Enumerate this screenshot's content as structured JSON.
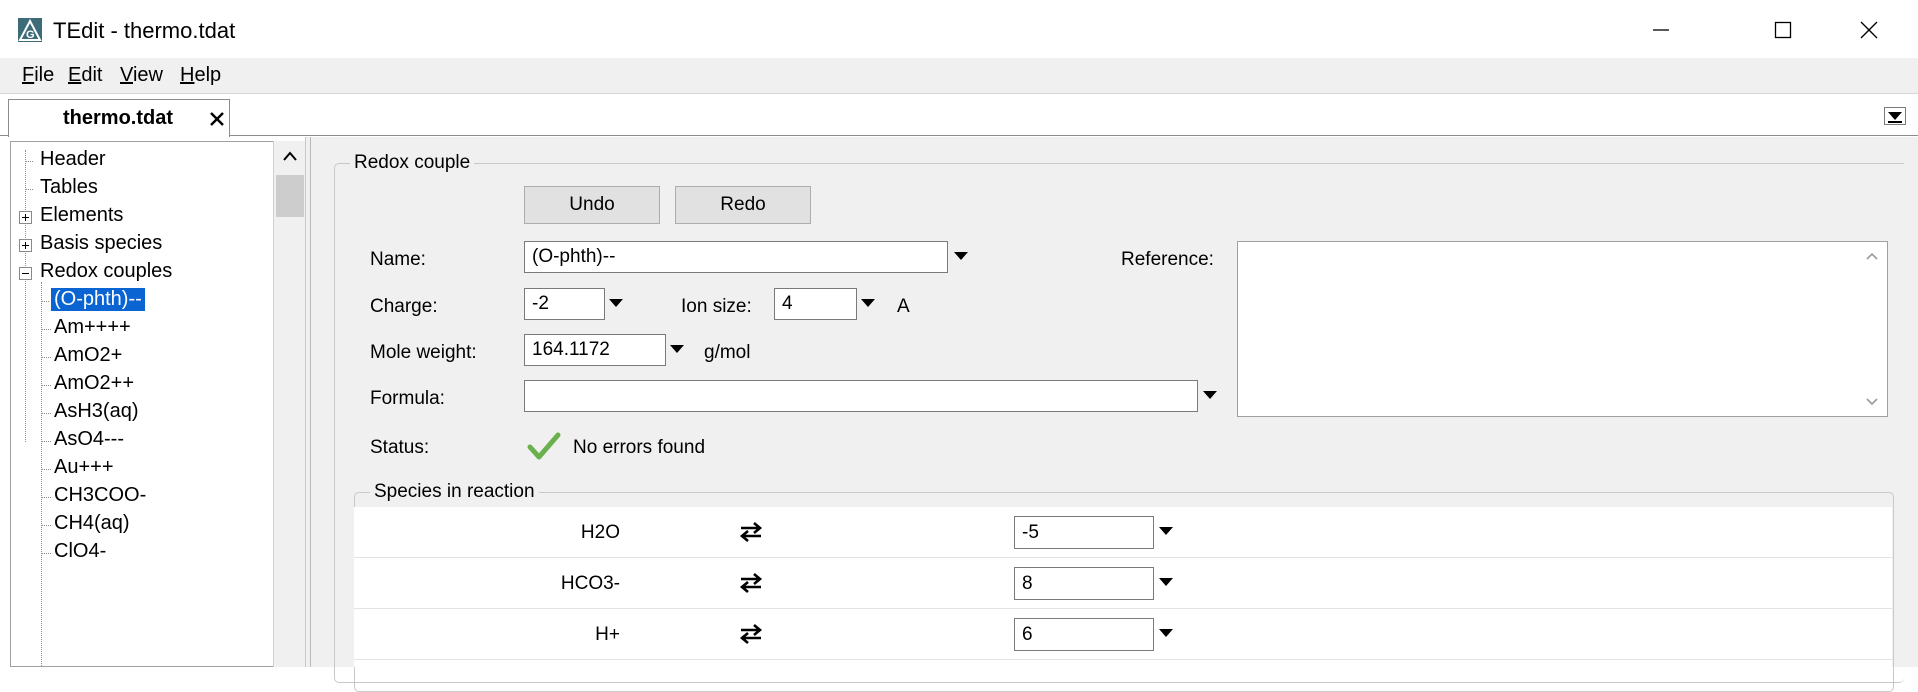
{
  "window": {
    "title": "TEdit - thermo.tdat",
    "controls": [
      "minimize-icon",
      "maximize-icon",
      "close-icon"
    ]
  },
  "menu": [
    {
      "key": "F",
      "rest": "ile"
    },
    {
      "key": "E",
      "rest": "dit"
    },
    {
      "key": "V",
      "rest": "iew"
    },
    {
      "key": "H",
      "rest": "elp"
    }
  ],
  "tab": {
    "label": "thermo.tdat"
  },
  "tree": {
    "items": [
      "Header",
      "Tables",
      "Elements",
      "Basis species",
      "Redox couples"
    ],
    "children": [
      "(O-phth)--",
      "Am++++",
      "AmO2+",
      "AmO2++",
      "AsH3(aq)",
      "AsO4---",
      "Au+++",
      "CH3COO-",
      "CH4(aq)",
      "ClO4-"
    ],
    "selected": "(O-phth)--"
  },
  "redox": {
    "group_label": "Redox couple",
    "undo_label": "Undo",
    "redo_label": "Redo",
    "name_label": "Name:",
    "name_value": "(O-phth)--",
    "charge_label": "Charge:",
    "charge_value": "-2",
    "ionsize_label": "Ion size:",
    "ionsize_value": "4",
    "ionsize_unit": "A",
    "moleweight_label": "Mole weight:",
    "moleweight_value": "164.1172",
    "moleweight_unit": "g/mol",
    "formula_label": "Formula:",
    "formula_value": "",
    "status_label": "Status:",
    "status_text": "No errors found",
    "reference_label": "Reference:",
    "reference_value": ""
  },
  "species": {
    "group_label": "Species in reaction",
    "rows": [
      {
        "name": "H2O",
        "coef": "-5"
      },
      {
        "name": "HCO3-",
        "coef": "8"
      },
      {
        "name": "H+",
        "coef": "6"
      }
    ]
  },
  "colors": {
    "selection": "#0a64d2",
    "status_ok": "#6ab04c",
    "panel_bg": "#f0f0f0"
  }
}
